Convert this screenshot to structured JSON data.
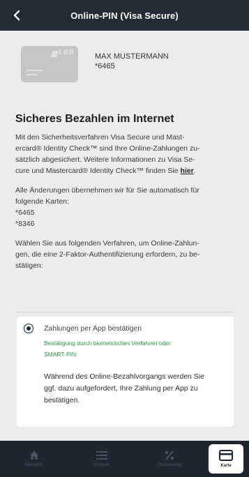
{
  "header": {
    "title": "Online-PIN (Visa Secure)",
    "back_icon": "chevron-left-icon"
  },
  "card": {
    "logo_text": "LBB",
    "holder": "MAX MUSTERMANN",
    "number": "*6465"
  },
  "main": {
    "heading": "Sicheres Bezahlen im Internet",
    "intro_lines": [
      "Mit den Sicherheitsverfahren Visa Secure und Mast-",
      "ercard® Identity Check™ sind Ihre Online-Zahlungen zu-",
      "sätzlich abgesichert. Weitere Informationen zu Visa Se-"
    ],
    "intro_last": "cure und Mastercard® Identity Check™ finden Sie ",
    "intro_link": "hier",
    "intro_end": ".",
    "changes_lines": [
      "Alle Änderungen übernehmen wir für Sie automatisch für",
      "folgende Karten:",
      "*6465",
      "*8346"
    ],
    "choose_lines": [
      "Wählen Sie aus folgenden Verfahren, um Online-Zahlun-",
      "gen, die eine 2-Faktor-Authentifizierung erfordern, zu be-",
      "stätigen:"
    ]
  },
  "option": {
    "selected": true,
    "title": "Zahlungen per App bestätigen",
    "sub_lines": [
      "Bestätigung durch biometrisches Verfahren oder",
      "SMART-PIN"
    ],
    "desc_lines": [
      "Während des Online-Bezahlvorgangs werden Sie",
      "ggf. dazu aufgefordert, Ihre Zahlung per App zu",
      "bestätigen."
    ]
  },
  "nav": {
    "items": [
      {
        "label": "Übersicht",
        "icon": "home-icon"
      },
      {
        "label": "Umsätze",
        "icon": "list-icon"
      },
      {
        "label": "Finanzierung",
        "icon": "percent-icon"
      },
      {
        "label": "Karte",
        "icon": "card-icon",
        "active": true
      }
    ]
  },
  "colors": {
    "header": "#242b36",
    "accent_green": "#2a9d3f",
    "nav": "#1f2632"
  }
}
